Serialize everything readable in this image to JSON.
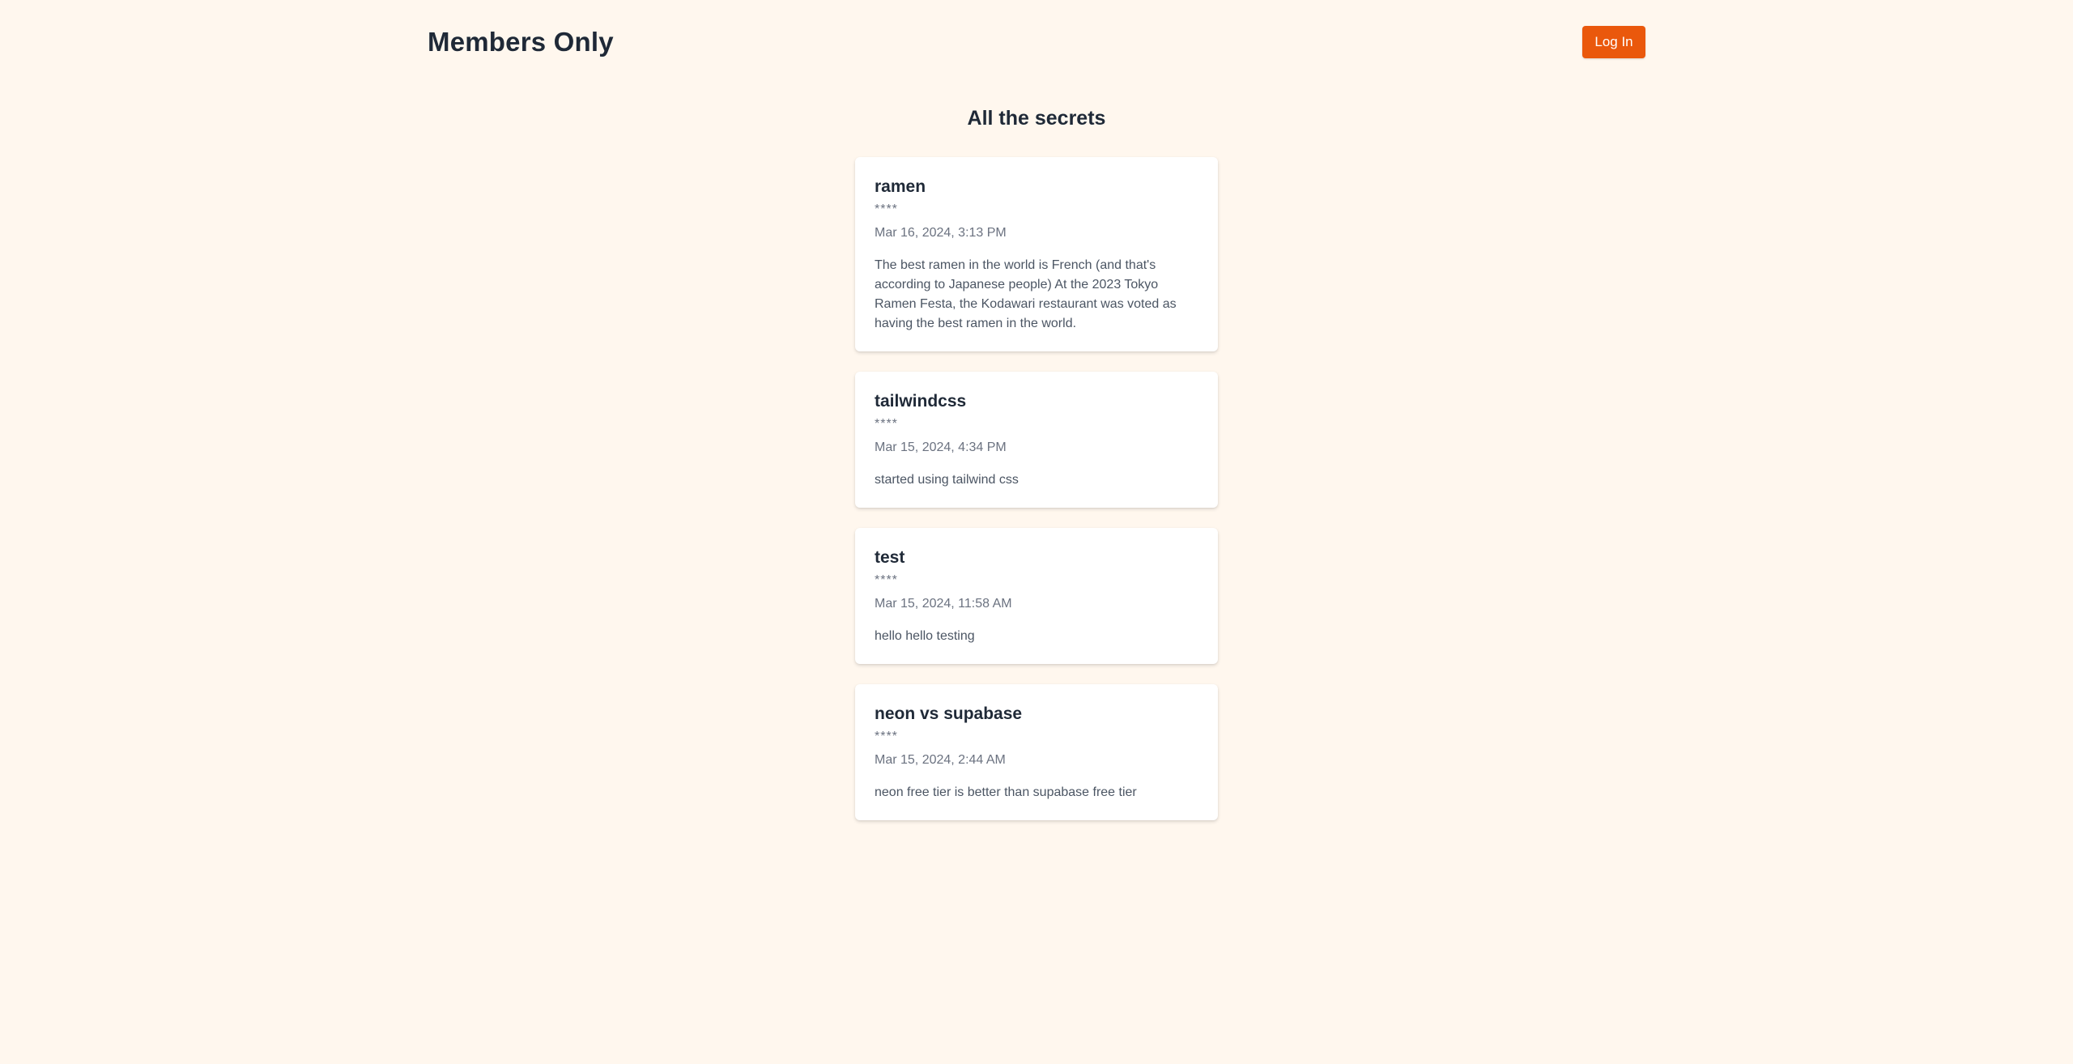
{
  "header": {
    "site_title": "Members Only",
    "login_label": "Log In"
  },
  "main": {
    "section_title": "All the secrets"
  },
  "posts": [
    {
      "title": "ramen",
      "author": "****",
      "date": "Mar 16, 2024, 3:13 PM",
      "body": "The best ramen in the world is French (and that's according to Japanese people) At the 2023 Tokyo Ramen Festa, the Kodawari restaurant was voted as having the best ramen in the world."
    },
    {
      "title": "tailwindcss",
      "author": "****",
      "date": "Mar 15, 2024, 4:34 PM",
      "body": "started using tailwind css"
    },
    {
      "title": "test",
      "author": "****",
      "date": "Mar 15, 2024, 11:58 AM",
      "body": "hello hello testing"
    },
    {
      "title": "neon vs supabase",
      "author": "****",
      "date": "Mar 15, 2024, 2:44 AM",
      "body": "neon free tier is better than supabase free tier"
    }
  ],
  "colors": {
    "background": "#fff7ee",
    "accent": "#ea580c",
    "text_primary": "#1f2937",
    "text_muted": "#6b7280"
  }
}
